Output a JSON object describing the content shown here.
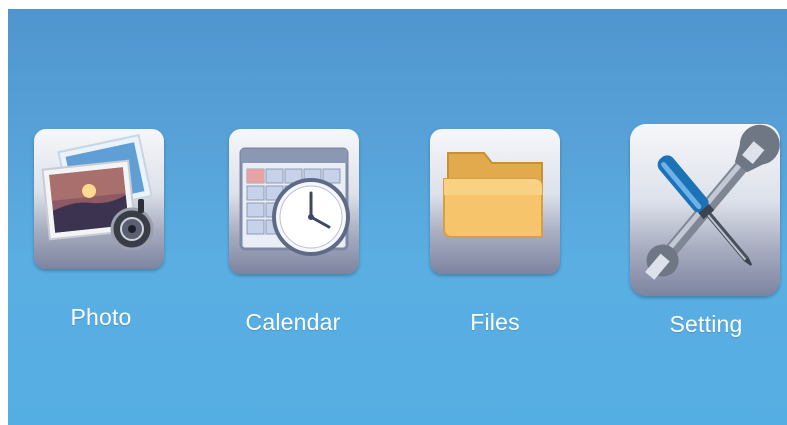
{
  "menu": {
    "items": [
      {
        "label": "Photo",
        "icon": "photo-icon"
      },
      {
        "label": "Calendar",
        "icon": "calendar-clock-icon"
      },
      {
        "label": "Files",
        "icon": "folder-icon"
      },
      {
        "label": "Setting",
        "icon": "wrench-screwdriver-icon"
      }
    ]
  },
  "colors": {
    "background_top": "#4f95cf",
    "background_bottom": "#55aee3",
    "label_text": "#ffffff"
  }
}
